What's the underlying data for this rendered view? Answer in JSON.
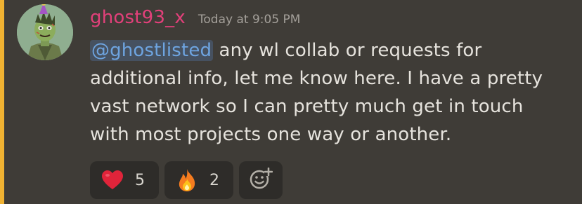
{
  "message": {
    "username": "ghost93_x",
    "timestamp": "Today at 9:05 PM",
    "mention": "@ghostlisted",
    "lines": [
      " any wl collab or requests for",
      "additional info, let me know here. I have a pretty",
      "vast network so I can pretty much get in touch",
      "with most projects one way or another."
    ]
  },
  "reactions": [
    {
      "emoji": "heart-icon",
      "count": "5"
    },
    {
      "emoji": "fire-icon",
      "count": "2"
    }
  ],
  "colors": {
    "background": "#3f3c37",
    "mention_bar": "#f0b232",
    "username": "#e2407a",
    "mention_text": "#6ea4e0",
    "reaction_bg": "#2e2c29"
  }
}
